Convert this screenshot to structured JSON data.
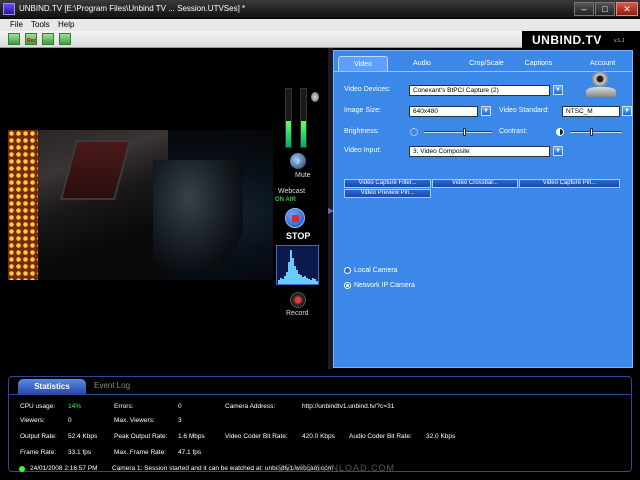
{
  "window": {
    "title": "UNBIND.TV [E:\\Program Files\\Unbind TV ... Session.UTVSes] *",
    "minimize": "–",
    "maximize": "□",
    "close": "✕"
  },
  "menu": {
    "file": "File",
    "tools": "Tools",
    "help": "Help"
  },
  "toolbar": {
    "rec_label": "Rec"
  },
  "brand": {
    "logo": "UNBIND.TV",
    "version": "v.1.1"
  },
  "side": {
    "mute": "Mute",
    "webcast": "Webcast",
    "on_air": "ON AIR",
    "stop": "STOP",
    "record": "Record"
  },
  "tabs": [
    "Video",
    "Audio",
    "Crop/Scale",
    "Captions",
    "Account"
  ],
  "video_settings": {
    "devices_label": "Video Devices:",
    "device_value": "Conexant's BtPCI Capture (2)",
    "image_size_label": "Image Size:",
    "image_size_value": "640x480",
    "standard_label": "Video Standard:",
    "standard_value": "NTSC_M",
    "brightness_label": "Brightness:",
    "brightness_level": 0.6,
    "contrast_label": "Contrast:",
    "contrast_level": 0.4,
    "input_label": "Video Input:",
    "input_value": "3: Video Composite",
    "buttons": [
      "Video Capture Filter...",
      "Video Crossbar...",
      "Video Capture Pin...",
      "Video Preview Pin..."
    ]
  },
  "source": {
    "local": "Local Camera",
    "network": "Network IP Camera",
    "selected": "network"
  },
  "stats": {
    "tab_active": "Statistics",
    "tab_other": "Event Log",
    "cpu_label": "CPU usage:",
    "cpu_value": "14%",
    "errors_label": "Errors:",
    "errors_value": "0",
    "address_label": "Camera Address:",
    "address_value": "http://unbindtv1.unbind.tv/?c=31",
    "viewers_label": "Viewers:",
    "viewers_value": "0",
    "max_viewers_label": "Max. Viewers:",
    "max_viewers_value": "3",
    "output_rate_label": "Output Rate:",
    "output_rate_value": "52.4 Kbps",
    "peak_rate_label": "Peak Output Rate:",
    "peak_rate_value": "1.6 Mbps",
    "vcoder_label": "Video Coder Bit Rate:",
    "vcoder_value": "420.0 Kbps",
    "acoder_label": "Audio Coder Bit Rate:",
    "acoder_value": "32.0 Kbps",
    "frame_rate_label": "Frame Rate:",
    "frame_rate_value": "33.1 fps",
    "max_frame_label": "Max. Frame Rate:",
    "max_frame_value": "47.1 fps",
    "status_time": "24/01/2008 2:16:57 PM",
    "status_msg": "Camera 1: Session started and it can be watched at: unbindtv1.webcam.com"
  },
  "watermark": "GEARDOWNLOAD.COM",
  "colors": {
    "panel": "#3c88e8",
    "accent": "#2a6ad0",
    "ok": "#33ff33"
  }
}
